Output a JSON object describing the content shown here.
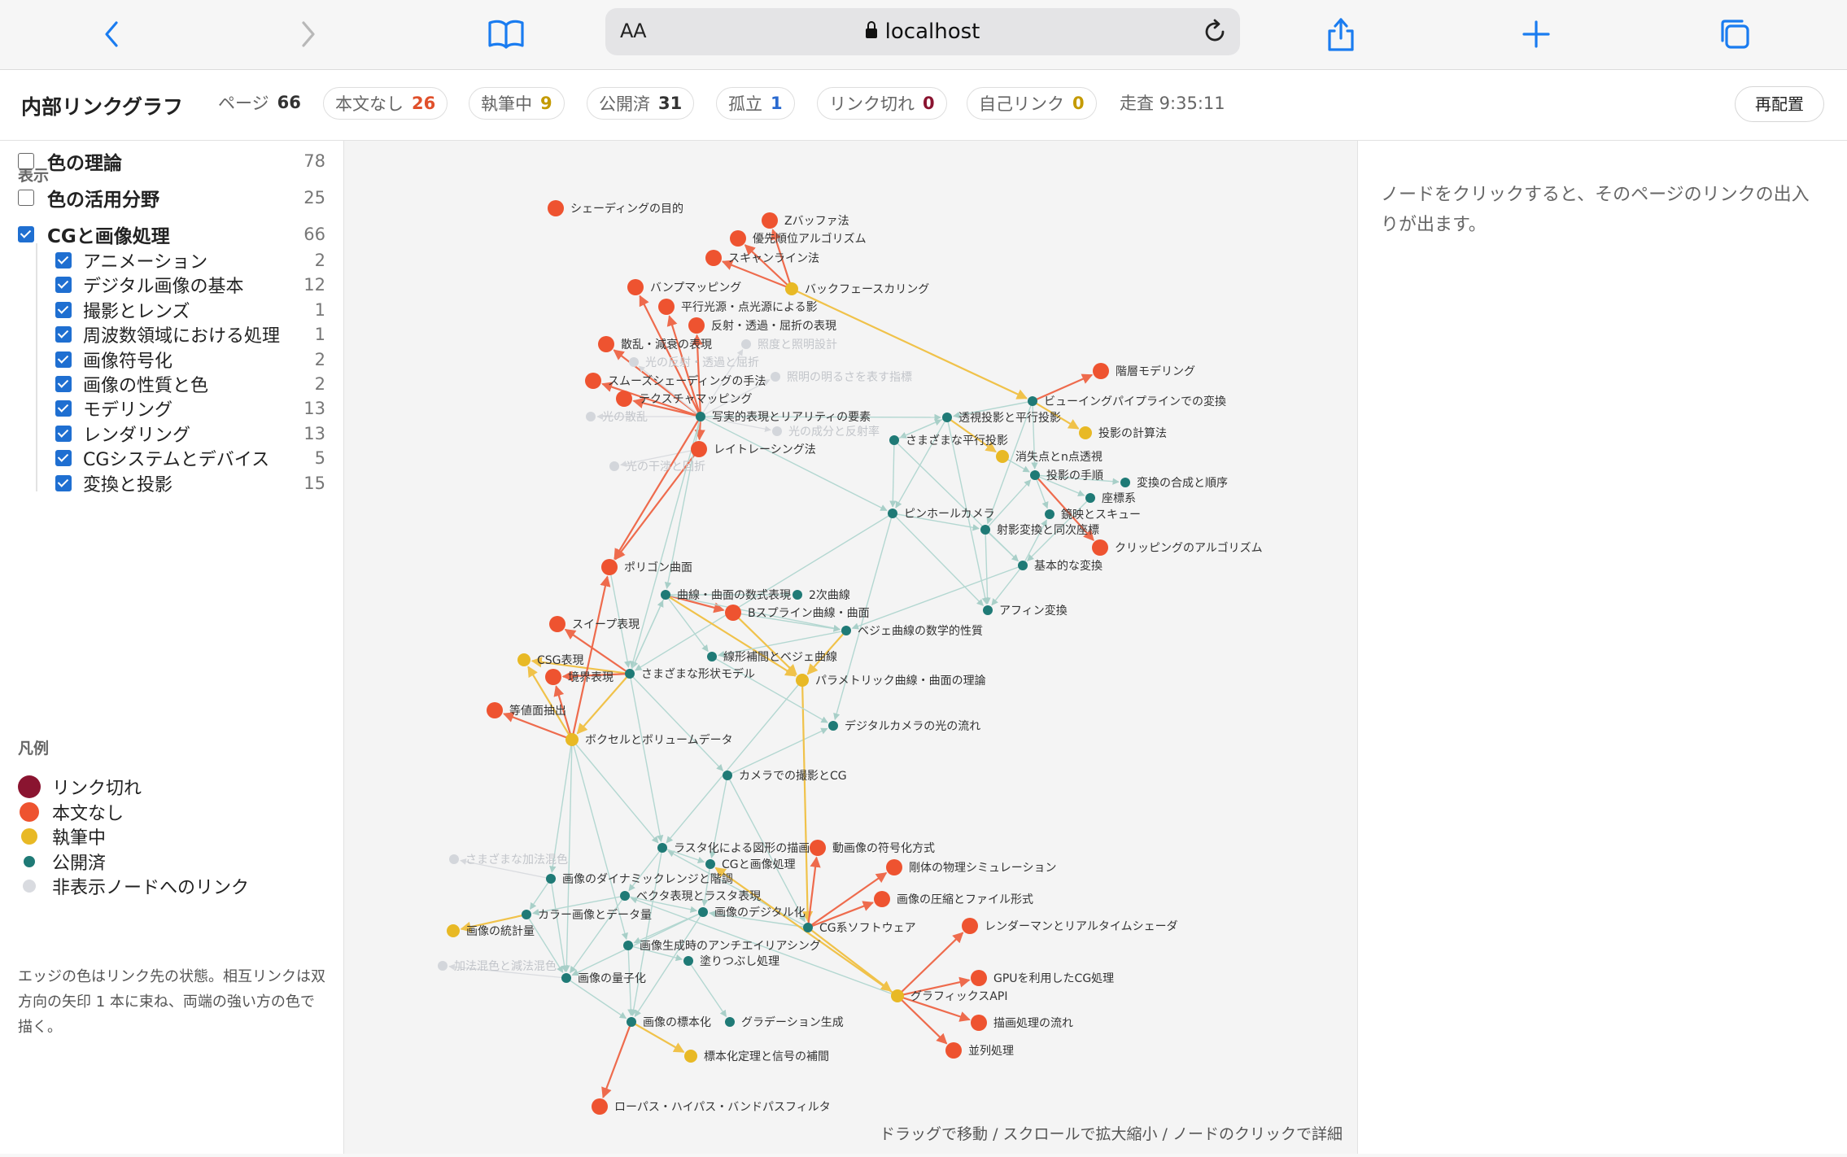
{
  "browser": {
    "address_aa": "AA",
    "url": "localhost",
    "colors": {
      "accent": "#1a7cf0",
      "disabled": "#b8b8b8"
    }
  },
  "header": {
    "title": "内部リンクグラフ",
    "pages_label": "ページ",
    "pages_value": "66",
    "stats": [
      {
        "label": "本文なし",
        "value": "26",
        "color": "#e0502b"
      },
      {
        "label": "執筆中",
        "value": "9",
        "color": "#c49a00"
      },
      {
        "label": "公開済",
        "value": "31",
        "color": "#333333"
      },
      {
        "label": "孤立",
        "value": "1",
        "color": "#2a6ad0"
      },
      {
        "label": "リンク切れ",
        "value": "0",
        "color": "#8a1430"
      },
      {
        "label": "自己リンク",
        "value": "0",
        "color": "#c49a00"
      }
    ],
    "scan": "走査 9:35:11",
    "relayout_button": "再配置"
  },
  "sidebar": {
    "display_heading": "表示",
    "top_filters": [
      {
        "label": "色の理論",
        "count": "78",
        "checked": false
      },
      {
        "label": "色の活用分野",
        "count": "25",
        "checked": false
      },
      {
        "label": "CGと画像処理",
        "count": "66",
        "checked": true
      }
    ],
    "sub_filters": [
      {
        "label": "アニメーション",
        "count": "2",
        "checked": true
      },
      {
        "label": "デジタル画像の基本",
        "count": "12",
        "checked": true
      },
      {
        "label": "撮影とレンズ",
        "count": "1",
        "checked": true
      },
      {
        "label": "周波数領域における処理",
        "count": "1",
        "checked": true
      },
      {
        "label": "画像符号化",
        "count": "2",
        "checked": true
      },
      {
        "label": "画像の性質と色",
        "count": "2",
        "checked": true
      },
      {
        "label": "モデリング",
        "count": "13",
        "checked": true
      },
      {
        "label": "レンダリング",
        "count": "13",
        "checked": true
      },
      {
        "label": "CGシステムとデバイス",
        "count": "5",
        "checked": true
      },
      {
        "label": "変換と投影",
        "count": "15",
        "checked": true
      }
    ],
    "legend_heading": "凡例",
    "legend": [
      {
        "label": "リンク切れ",
        "color": "#8a1430"
      },
      {
        "label": "本文なし",
        "color": "#ee5330"
      },
      {
        "label": "執筆中",
        "color": "#e8b925"
      },
      {
        "label": "公開済",
        "color": "#1f7a76"
      },
      {
        "label": "非表示ノードへのリンク",
        "color": "#d9dbe0"
      }
    ],
    "note": "エッジの色はリンク先の状態。相互リンクは双方向の矢印 1 本に束ね、両端の強い方の色で描く。"
  },
  "graph": {
    "hint": "ドラッグで移動 / スクロールで拡大縮小 / ノードのクリックで詳細",
    "status_colors": {
      "nobody": "#ee5330",
      "draft": "#e8b925",
      "published": "#1f7a76",
      "hidden": "#d3d6db"
    },
    "nodes": [
      {
        "id": 1,
        "label": "シェーディングの目的",
        "status": "nobody"
      },
      {
        "id": 2,
        "label": "Zバッファ法",
        "status": "nobody"
      },
      {
        "id": 3,
        "label": "優先順位アルゴリズム",
        "status": "nobody"
      },
      {
        "id": 4,
        "label": "スキャンライン法",
        "status": "nobody"
      },
      {
        "id": 5,
        "label": "バンプマッピング",
        "status": "nobody"
      },
      {
        "id": 6,
        "label": "バックフェースカリング",
        "status": "draft"
      },
      {
        "id": 7,
        "label": "平行光源・点光源による影",
        "status": "nobody"
      },
      {
        "id": 8,
        "label": "反射・透過・屈折の表現",
        "status": "nobody"
      },
      {
        "id": 9,
        "label": "散乱・減衰の表現",
        "status": "nobody"
      },
      {
        "id": 10,
        "label": "照度と照明設計",
        "status": "hidden"
      },
      {
        "id": 11,
        "label": "光の反射・透過と屈折",
        "status": "hidden"
      },
      {
        "id": 12,
        "label": "スムーズシェーディングの手法",
        "status": "nobody"
      },
      {
        "id": 13,
        "label": "照明の明るさを表す指標",
        "status": "hidden"
      },
      {
        "id": 14,
        "label": "テクスチャマッピング",
        "status": "nobody"
      },
      {
        "id": 15,
        "label": "光の散乱",
        "status": "hidden"
      },
      {
        "id": 16,
        "label": "写実的表現とリアリティの要素",
        "status": "published"
      },
      {
        "id": 17,
        "label": "光の成分と反射率",
        "status": "hidden"
      },
      {
        "id": 18,
        "label": "レイトレーシング法",
        "status": "nobody"
      },
      {
        "id": 19,
        "label": "光の干渉と回折",
        "status": "hidden"
      },
      {
        "id": 20,
        "label": "階層モデリング",
        "status": "nobody"
      },
      {
        "id": 21,
        "label": "ビューイングパイプラインでの変換",
        "status": "published"
      },
      {
        "id": 22,
        "label": "透視投影と平行投影",
        "status": "published"
      },
      {
        "id": 23,
        "label": "投影の計算法",
        "status": "draft"
      },
      {
        "id": 24,
        "label": "さまざまな平行投影",
        "status": "published"
      },
      {
        "id": 25,
        "label": "消失点とn点透視",
        "status": "draft"
      },
      {
        "id": 26,
        "label": "投影の手順",
        "status": "published"
      },
      {
        "id": 27,
        "label": "変換の合成と順序",
        "status": "published"
      },
      {
        "id": 28,
        "label": "座標系",
        "status": "published"
      },
      {
        "id": 29,
        "label": "ピンホールカメラ",
        "status": "published"
      },
      {
        "id": 30,
        "label": "鏡映とスキュー",
        "status": "published"
      },
      {
        "id": 31,
        "label": "射影変換と同次座標",
        "status": "published"
      },
      {
        "id": 32,
        "label": "クリッピングのアルゴリズム",
        "status": "nobody"
      },
      {
        "id": 33,
        "label": "基本的な変換",
        "status": "published"
      },
      {
        "id": 34,
        "label": "ポリゴン曲面",
        "status": "nobody"
      },
      {
        "id": 35,
        "label": "曲線・曲面の数式表現",
        "status": "published"
      },
      {
        "id": 36,
        "label": "2次曲線",
        "status": "published"
      },
      {
        "id": 37,
        "label": "Bスプライン曲線・曲面",
        "status": "nobody"
      },
      {
        "id": 38,
        "label": "アフィン変換",
        "status": "published"
      },
      {
        "id": 39,
        "label": "スイープ表現",
        "status": "nobody"
      },
      {
        "id": 40,
        "label": "ベジェ曲線の数学的性質",
        "status": "published"
      },
      {
        "id": 41,
        "label": "線形補間とベジェ曲線",
        "status": "published"
      },
      {
        "id": 42,
        "label": "CSG表現",
        "status": "draft"
      },
      {
        "id": 43,
        "label": "境界表現",
        "status": "nobody"
      },
      {
        "id": 44,
        "label": "さまざまな形状モデル",
        "status": "published"
      },
      {
        "id": 45,
        "label": "パラメトリック曲線・曲面の理論",
        "status": "draft"
      },
      {
        "id": 46,
        "label": "等値面抽出",
        "status": "nobody"
      },
      {
        "id": 47,
        "label": "デジタルカメラの光の流れ",
        "status": "published"
      },
      {
        "id": 48,
        "label": "ボクセルとボリュームデータ",
        "status": "draft"
      },
      {
        "id": 49,
        "label": "カメラでの撮影とCG",
        "status": "published"
      },
      {
        "id": 50,
        "label": "ラスタ化による図形の描画",
        "status": "published"
      },
      {
        "id": 51,
        "label": "動画像の符号化方式",
        "status": "nobody"
      },
      {
        "id": 52,
        "label": "さまざまな加法混色",
        "status": "hidden"
      },
      {
        "id": 53,
        "label": "CGと画像処理",
        "status": "published"
      },
      {
        "id": 54,
        "label": "剛体の物理シミュレーション",
        "status": "nobody"
      },
      {
        "id": 55,
        "label": "画像のダイナミックレンジと階調",
        "status": "published"
      },
      {
        "id": 56,
        "label": "ベクタ表現とラスタ表現",
        "status": "published"
      },
      {
        "id": 57,
        "label": "画像の圧縮とファイル形式",
        "status": "nobody"
      },
      {
        "id": 58,
        "label": "カラー画像とデータ量",
        "status": "published"
      },
      {
        "id": 59,
        "label": "画像のデジタル化",
        "status": "published"
      },
      {
        "id": 60,
        "label": "画像の統計量",
        "status": "draft"
      },
      {
        "id": 61,
        "label": "CG系ソフトウェア",
        "status": "published"
      },
      {
        "id": 62,
        "label": "レンダーマンとリアルタイムシェーダ",
        "status": "nobody"
      },
      {
        "id": 63,
        "label": "画像生成時のアンチエイリアシング",
        "status": "published"
      },
      {
        "id": 64,
        "label": "塗りつぶし処理",
        "status": "published"
      },
      {
        "id": 65,
        "label": "加法混色と減法混色",
        "status": "hidden"
      },
      {
        "id": 66,
        "label": "画像の量子化",
        "status": "published"
      },
      {
        "id": 67,
        "label": "GPUを利用したCG処理",
        "status": "nobody"
      },
      {
        "id": 68,
        "label": "グラフィックスAPI",
        "status": "draft"
      },
      {
        "id": 69,
        "label": "画像の標本化",
        "status": "published"
      },
      {
        "id": 70,
        "label": "グラデーション生成",
        "status": "published"
      },
      {
        "id": 71,
        "label": "描画処理の流れ",
        "status": "nobody"
      },
      {
        "id": 72,
        "label": "並列処理",
        "status": "nobody"
      },
      {
        "id": 73,
        "label": "標本化定理と信号の補間",
        "status": "draft"
      },
      {
        "id": 74,
        "label": "ローパス・ハイパス・バンドパスフィルタ",
        "status": "nobody"
      }
    ]
  },
  "detail": {
    "placeholder": "ノードをクリックすると、そのページのリンクの出入りが出ます。"
  }
}
